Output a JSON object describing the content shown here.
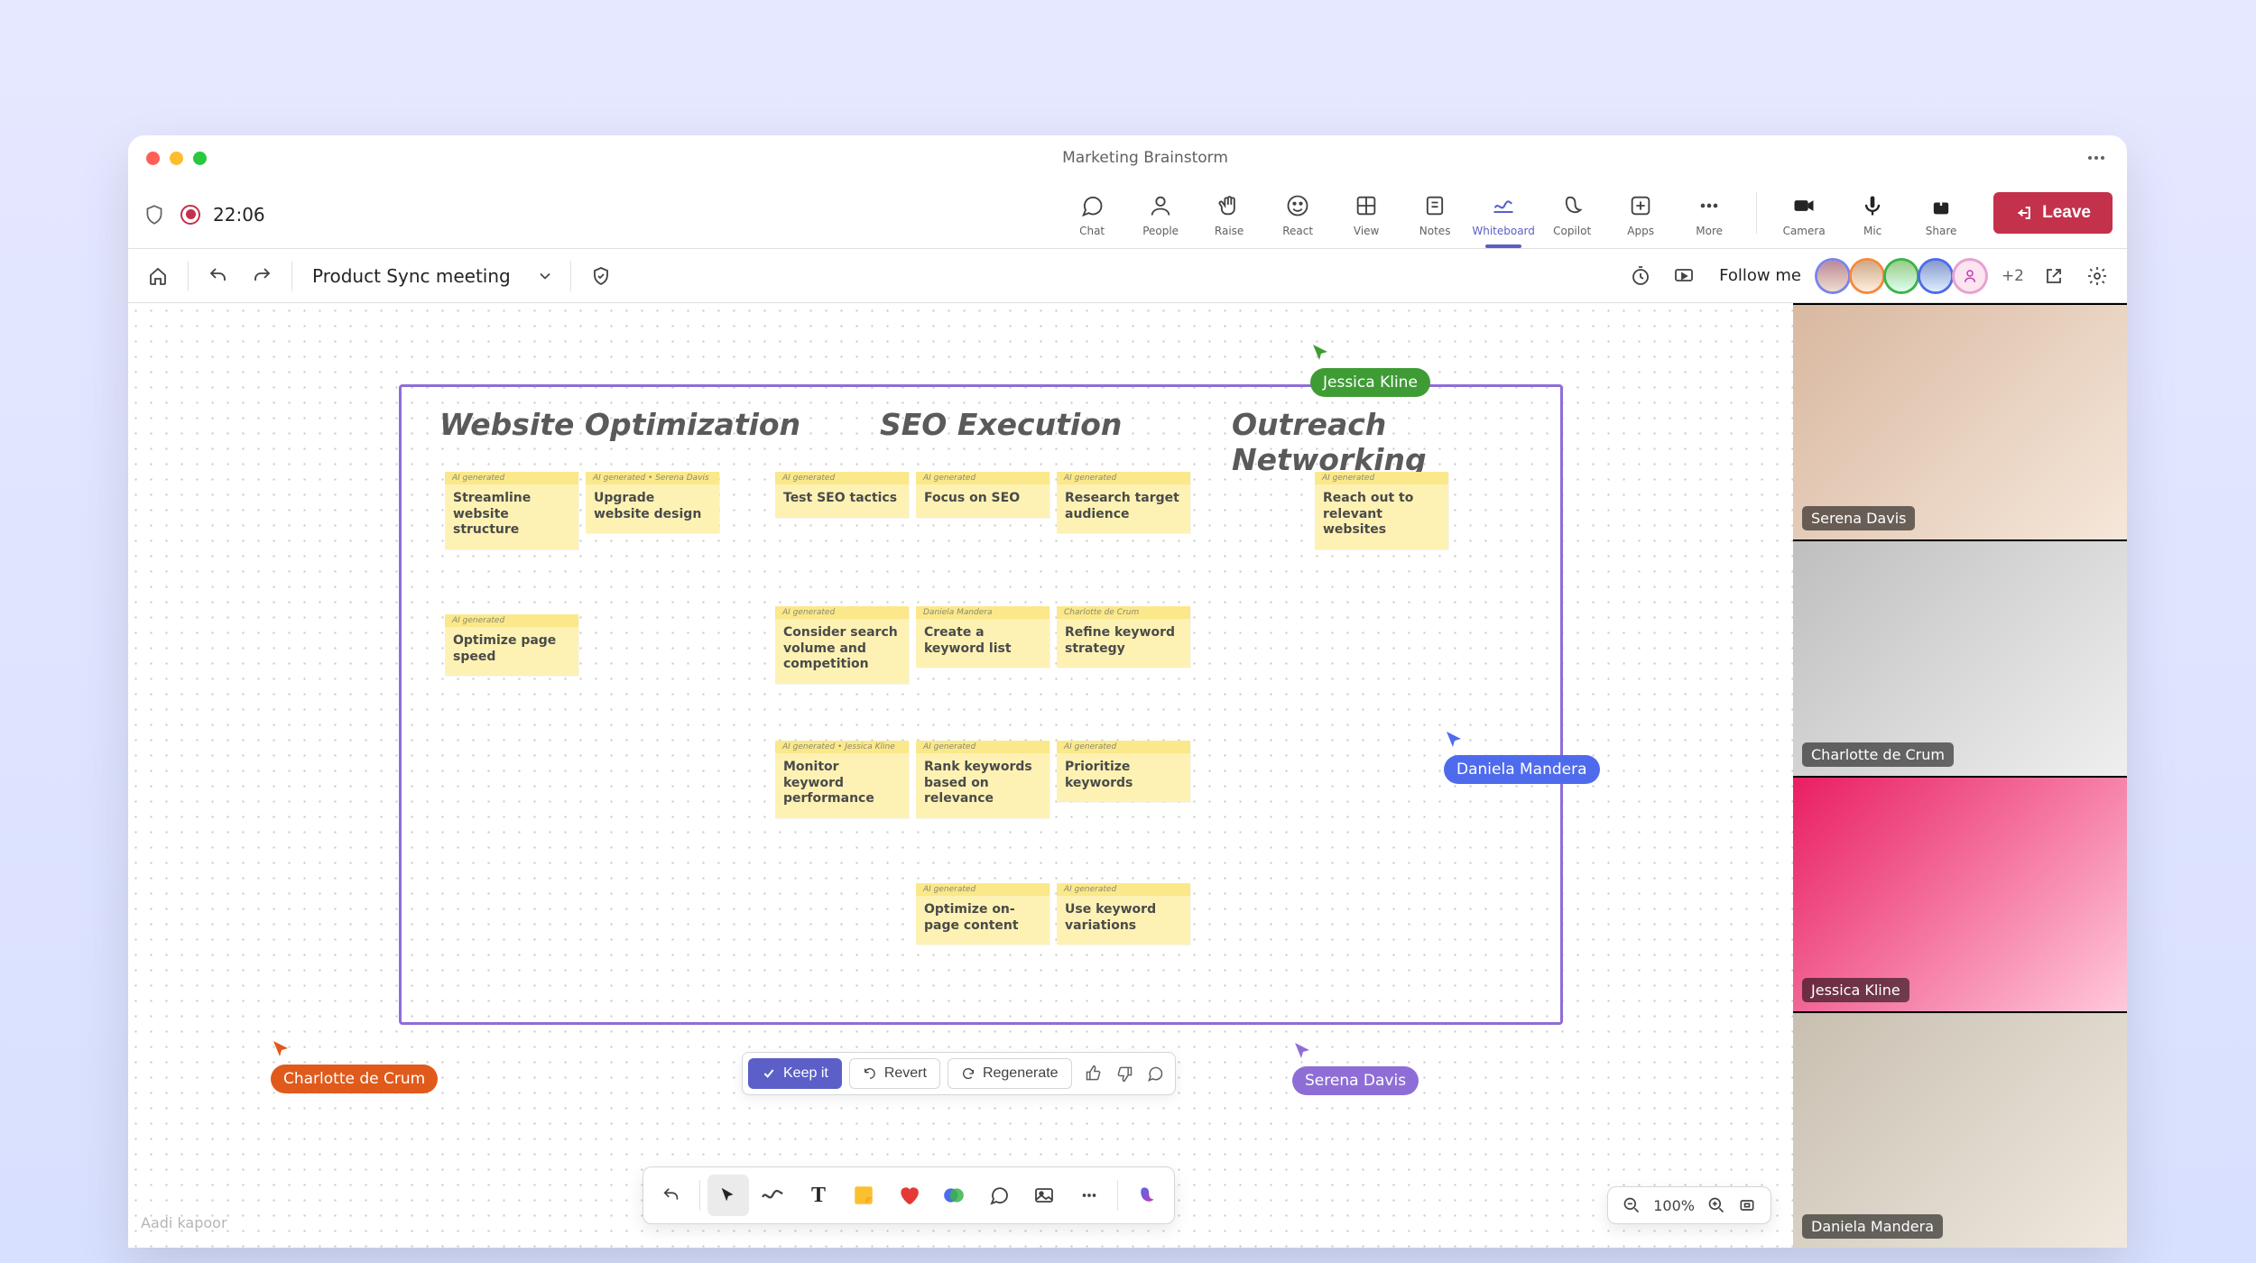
{
  "window_title": "Marketing Brainstorm",
  "timer": "22:06",
  "meet_actions": {
    "chat": "Chat",
    "people": "People",
    "raise": "Raise",
    "react": "React",
    "view": "View",
    "notes": "Notes",
    "whiteboard": "Whiteboard",
    "copilot": "Copilot",
    "apps": "Apps",
    "more": "More",
    "camera": "Camera",
    "mic": "Mic",
    "share": "Share",
    "leave": "Leave"
  },
  "whiteboard": {
    "meeting_name": "Product Sync meeting",
    "follow": "Follow me",
    "plus_count": "+2"
  },
  "participants": [
    "Serena Davis",
    "Charlotte de Crum",
    "Jessica Kline",
    "Daniela Mandera"
  ],
  "cursors": {
    "jessica": "Jessica Kline",
    "daniela": "Daniela Mandera",
    "charlotte": "Charlotte de Crum",
    "serena": "Serena Davis"
  },
  "columns": {
    "c1": "Website Optimization",
    "c2": "SEO Execution",
    "c3": "Outreach Networking"
  },
  "tags": {
    "ai": "AI generated",
    "ai_serena": "AI generated • Serena Davis",
    "ai_jessica": "AI generated • Jessica Kline",
    "daniela": "Daniela Mandera",
    "charlotte": "Charlotte de Crum"
  },
  "notes": {
    "n1": "Streamline website structure",
    "n2": "Upgrade website design",
    "n3": "Optimize page speed",
    "s1": "Test SEO tactics",
    "s2": "Focus on SEO",
    "s3": "Research target audience",
    "s4": "Consider search volume and competition",
    "s5": "Create a keyword list",
    "s6": "Refine keyword strategy",
    "s7": "Monitor keyword performance",
    "s8": "Rank keywords based on relevance",
    "s9": "Prioritize keywords",
    "s10": "Optimize on-page content",
    "s11": "Use keyword variations",
    "o1": "Reach out to relevant websites"
  },
  "genbar": {
    "keep": "Keep it",
    "revert": "Revert",
    "regen": "Regenerate"
  },
  "zoom": "100%",
  "watermark": "Aadi kapoor"
}
